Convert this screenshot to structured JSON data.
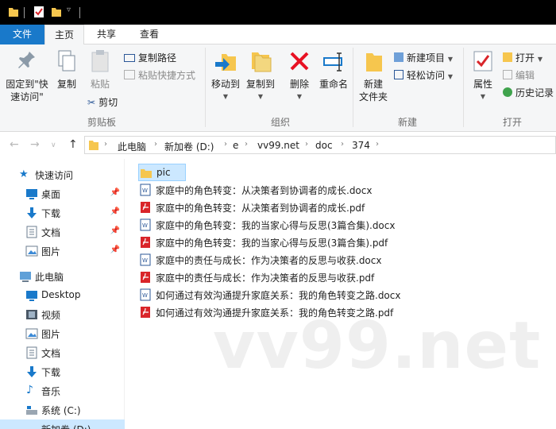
{
  "window": {
    "quick_access_icons": [
      "folder-icon",
      "properties-icon",
      "new-folder-icon",
      "customize-dropdown-icon"
    ]
  },
  "menu": {
    "tabs": [
      {
        "label": "文件",
        "active": false
      },
      {
        "label": "主页",
        "active": true
      },
      {
        "label": "共享",
        "active": false
      },
      {
        "label": "查看",
        "active": false
      }
    ]
  },
  "ribbon": {
    "clipboard": {
      "pin_label_1": "固定到\"快",
      "pin_label_2": "速访问\"",
      "copy": "复制",
      "paste": "粘贴",
      "copy_path": "复制路径",
      "paste_shortcut": "粘贴快捷方式",
      "cut": "剪切",
      "group": "剪贴板"
    },
    "organize": {
      "move_to": "移动到",
      "copy_to": "复制到",
      "delete": "删除",
      "rename": "重命名",
      "group": "组织"
    },
    "new": {
      "new_folder_1": "新建",
      "new_folder_2": "文件夹",
      "new_item": "新建项目",
      "easy_access": "轻松访问",
      "group": "新建"
    },
    "open": {
      "properties": "属性",
      "open": "打开",
      "edit": "编辑",
      "history": "历史记录",
      "group": "打开"
    }
  },
  "address": {
    "crumbs": [
      "此电脑",
      "新加卷 (D:)",
      "e",
      "vv99.net",
      "doc",
      "374"
    ]
  },
  "nav": {
    "items": [
      {
        "label": "快速访问",
        "icon": "star-icon",
        "pinned": false
      },
      {
        "label": "桌面",
        "icon": "desktop-icon",
        "pinned": true
      },
      {
        "label": "下载",
        "icon": "download-icon",
        "pinned": true
      },
      {
        "label": "文档",
        "icon": "document-icon",
        "pinned": true
      },
      {
        "label": "图片",
        "icon": "pictures-icon",
        "pinned": true
      },
      {
        "label": "此电脑",
        "icon": "computer-icon",
        "pinned": false
      },
      {
        "label": "Desktop",
        "icon": "desktop-icon",
        "pinned": false
      },
      {
        "label": "视频",
        "icon": "video-icon",
        "pinned": false
      },
      {
        "label": "图片",
        "icon": "pictures-icon",
        "pinned": false
      },
      {
        "label": "文档",
        "icon": "document-icon",
        "pinned": false
      },
      {
        "label": "下载",
        "icon": "download-icon",
        "pinned": false
      },
      {
        "label": "音乐",
        "icon": "music-icon",
        "pinned": false
      },
      {
        "label": "系统 (C:)",
        "icon": "drive-icon",
        "pinned": false
      },
      {
        "label": "新加卷 (D:)",
        "icon": "drive-icon",
        "pinned": false
      }
    ]
  },
  "files": [
    {
      "name": "pic",
      "type": "folder"
    },
    {
      "name": "家庭中的角色转变：从决策者到协调者的成长.docx",
      "type": "docx"
    },
    {
      "name": "家庭中的角色转变：从决策者到协调者的成长.pdf",
      "type": "pdf"
    },
    {
      "name": "家庭中的角色转变：我的当家心得与反思(3篇合集).docx",
      "type": "docx"
    },
    {
      "name": "家庭中的角色转变：我的当家心得与反思(3篇合集).pdf",
      "type": "pdf"
    },
    {
      "name": "家庭中的责任与成长：作为决策者的反思与收获.docx",
      "type": "docx"
    },
    {
      "name": "家庭中的责任与成长：作为决策者的反思与收获.pdf",
      "type": "pdf"
    },
    {
      "name": "如何通过有效沟通提升家庭关系：我的角色转变之路.docx",
      "type": "docx"
    },
    {
      "name": "如何通过有效沟通提升家庭关系：我的角色转变之路.pdf",
      "type": "pdf"
    }
  ],
  "watermark": "vv99.net",
  "colors": {
    "accent": "#1979ca",
    "folder": "#f6c64e",
    "word": "#2b5797",
    "pdf": "#d9252a",
    "selection": "#cce8ff",
    "delete": "#e81123"
  }
}
